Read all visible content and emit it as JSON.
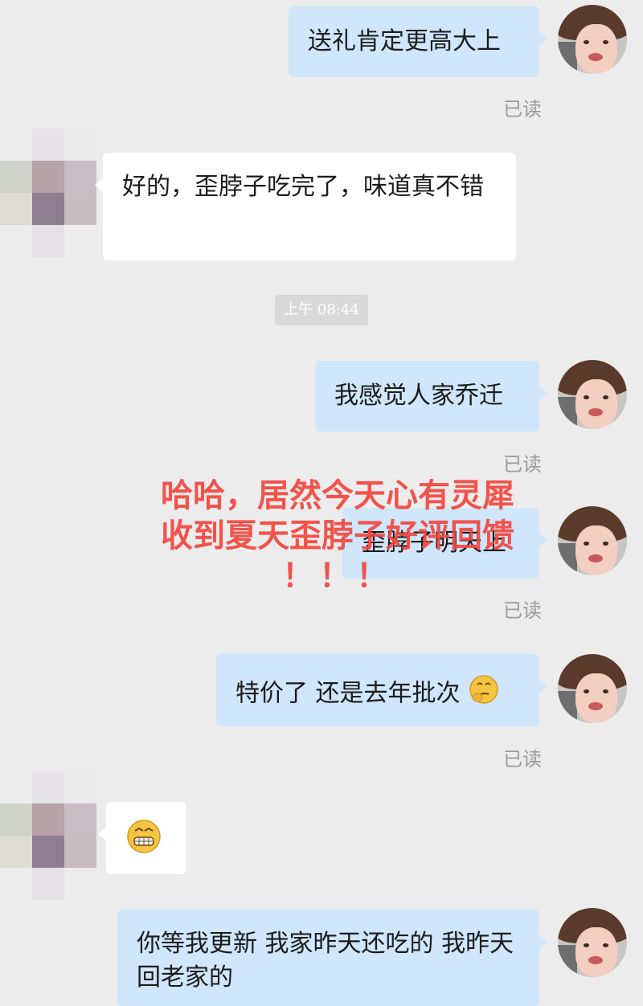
{
  "messages": {
    "m1": {
      "text": "送礼肯定更高大上",
      "status": "已读"
    },
    "m2": {
      "text": "好的，歪脖子吃完了，味道真不错"
    },
    "timestamp": "上午 08:44",
    "m3": {
      "text": "我感觉人家乔迁",
      "status": "已读"
    },
    "m4": {
      "text": "歪脖子明天上",
      "status": "已读"
    },
    "m5": {
      "text": "特价了 还是去年批次",
      "emoji": "thinking-face-icon",
      "status": "已读"
    },
    "m6": {
      "emoji": "grinning-face-icon"
    },
    "m7": {
      "text": "你等我更新 我家昨天还吃的 我昨天回老家的"
    }
  },
  "overlay": {
    "line1": "哈哈，居然今天心有灵犀",
    "line2": "收到夏天歪脖子好评回馈",
    "line3": "！！！"
  },
  "colors": {
    "my_bubble": "#cfe6fb",
    "their_bubble": "#ffffff",
    "background": "#ececec",
    "overlay_text": "#f2473f"
  }
}
